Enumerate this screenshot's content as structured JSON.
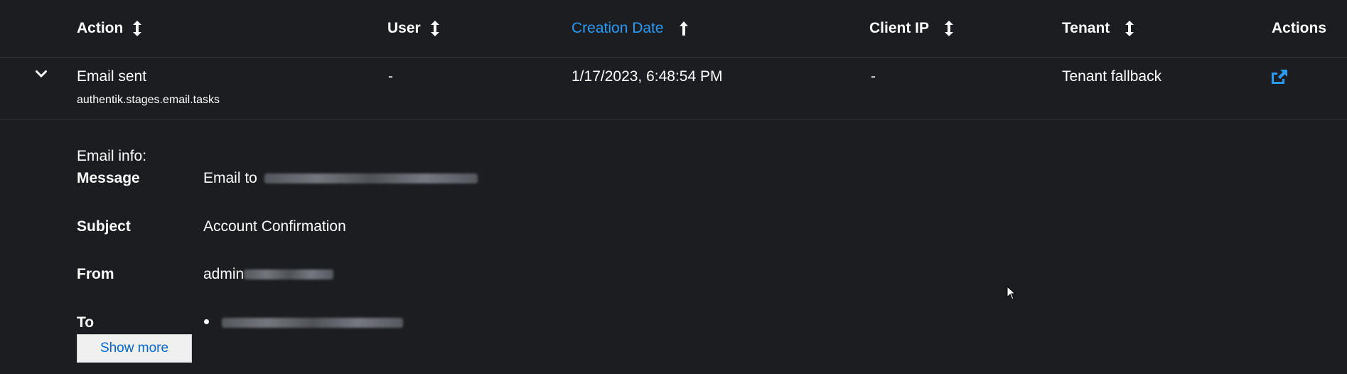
{
  "table": {
    "columns": [
      {
        "key": "action",
        "label": "Action",
        "sort": "both"
      },
      {
        "key": "user",
        "label": "User",
        "sort": "both"
      },
      {
        "key": "created",
        "label": "Creation Date",
        "sort": "asc",
        "active": true
      },
      {
        "key": "client_ip",
        "label": "Client IP",
        "sort": "both"
      },
      {
        "key": "tenant",
        "label": "Tenant",
        "sort": "both"
      },
      {
        "key": "actions",
        "label": "Actions"
      }
    ],
    "row": {
      "action": "Email sent",
      "app": "authentik.stages.email.tasks",
      "user": "-",
      "created": "1/17/2023, 6:48:54 PM",
      "client_ip": "-",
      "tenant": "Tenant fallback",
      "action_icon": "external-link-icon",
      "expand_icon": "chevron-down-icon"
    }
  },
  "details": {
    "heading": "Email info:",
    "message_label": "Message",
    "message_value": "Email to",
    "subject_label": "Subject",
    "subject_value": "Account Confirmation",
    "from_label": "From",
    "from_value": "admin",
    "to_label": "To",
    "show_more": "Show more"
  },
  "colors": {
    "background": "#1b1d21",
    "accent": "#2b9af3",
    "divider": "#33363b"
  }
}
